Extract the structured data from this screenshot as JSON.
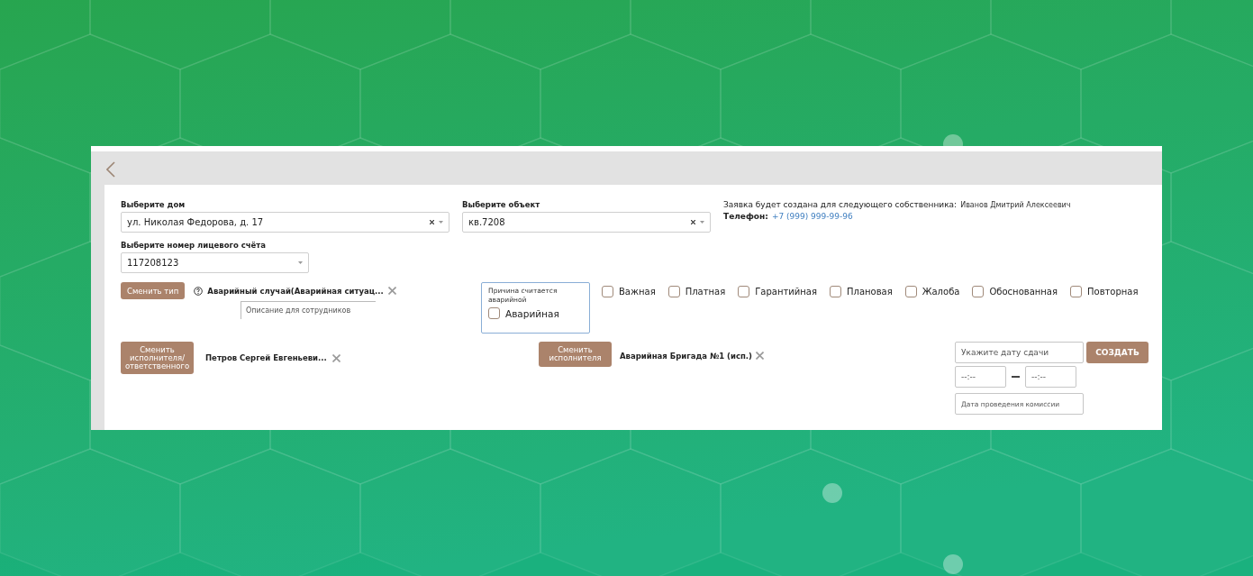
{
  "house": {
    "label": "Выберите дом",
    "value": "ул. Николая Федорова, д. 17"
  },
  "object": {
    "label": "Выберите объект",
    "value": "кв.7208"
  },
  "owner": {
    "intro": "Заявка будет создана для следующего собственника:",
    "name": "Иванов Дмитрий Алексеевич",
    "phone_label": "Телефон:",
    "phone": "+7 (999) 999-99-96"
  },
  "account": {
    "label": "Выберите номер лицевого счёта",
    "value": "117208123"
  },
  "type": {
    "button": "Сменить тип",
    "value": "Аварийный случай(Аварийная ситуац...",
    "description_placeholder": "Описание для сотрудников"
  },
  "emergency": {
    "caption": "Причина считается аварийной",
    "label": "Аварийная",
    "checked": false
  },
  "flags": [
    {
      "label": "Важная",
      "checked": false
    },
    {
      "label": "Платная",
      "checked": false
    },
    {
      "label": "Гарантийная",
      "checked": false
    },
    {
      "label": "Плановая",
      "checked": false
    },
    {
      "label": "Жалоба",
      "checked": false
    },
    {
      "label": "Обоснованная",
      "checked": false
    },
    {
      "label": "Повторная",
      "checked": false
    }
  ],
  "responsible": {
    "button": "Сменить исполнителя/ ответственного",
    "value": "Петров Сергей Евгеньеви..."
  },
  "executor": {
    "button": "Сменить исполнителя",
    "value": "Аварийная Бригада №1 (исп.)"
  },
  "due_date": {
    "placeholder": "Укажите дату сдачи"
  },
  "create_button": "СОЗДАТЬ",
  "time_from": {
    "placeholder": "--:--"
  },
  "time_to": {
    "placeholder": "--:--"
  },
  "commission_date": {
    "placeholder": "Дата проведения комиссии"
  }
}
